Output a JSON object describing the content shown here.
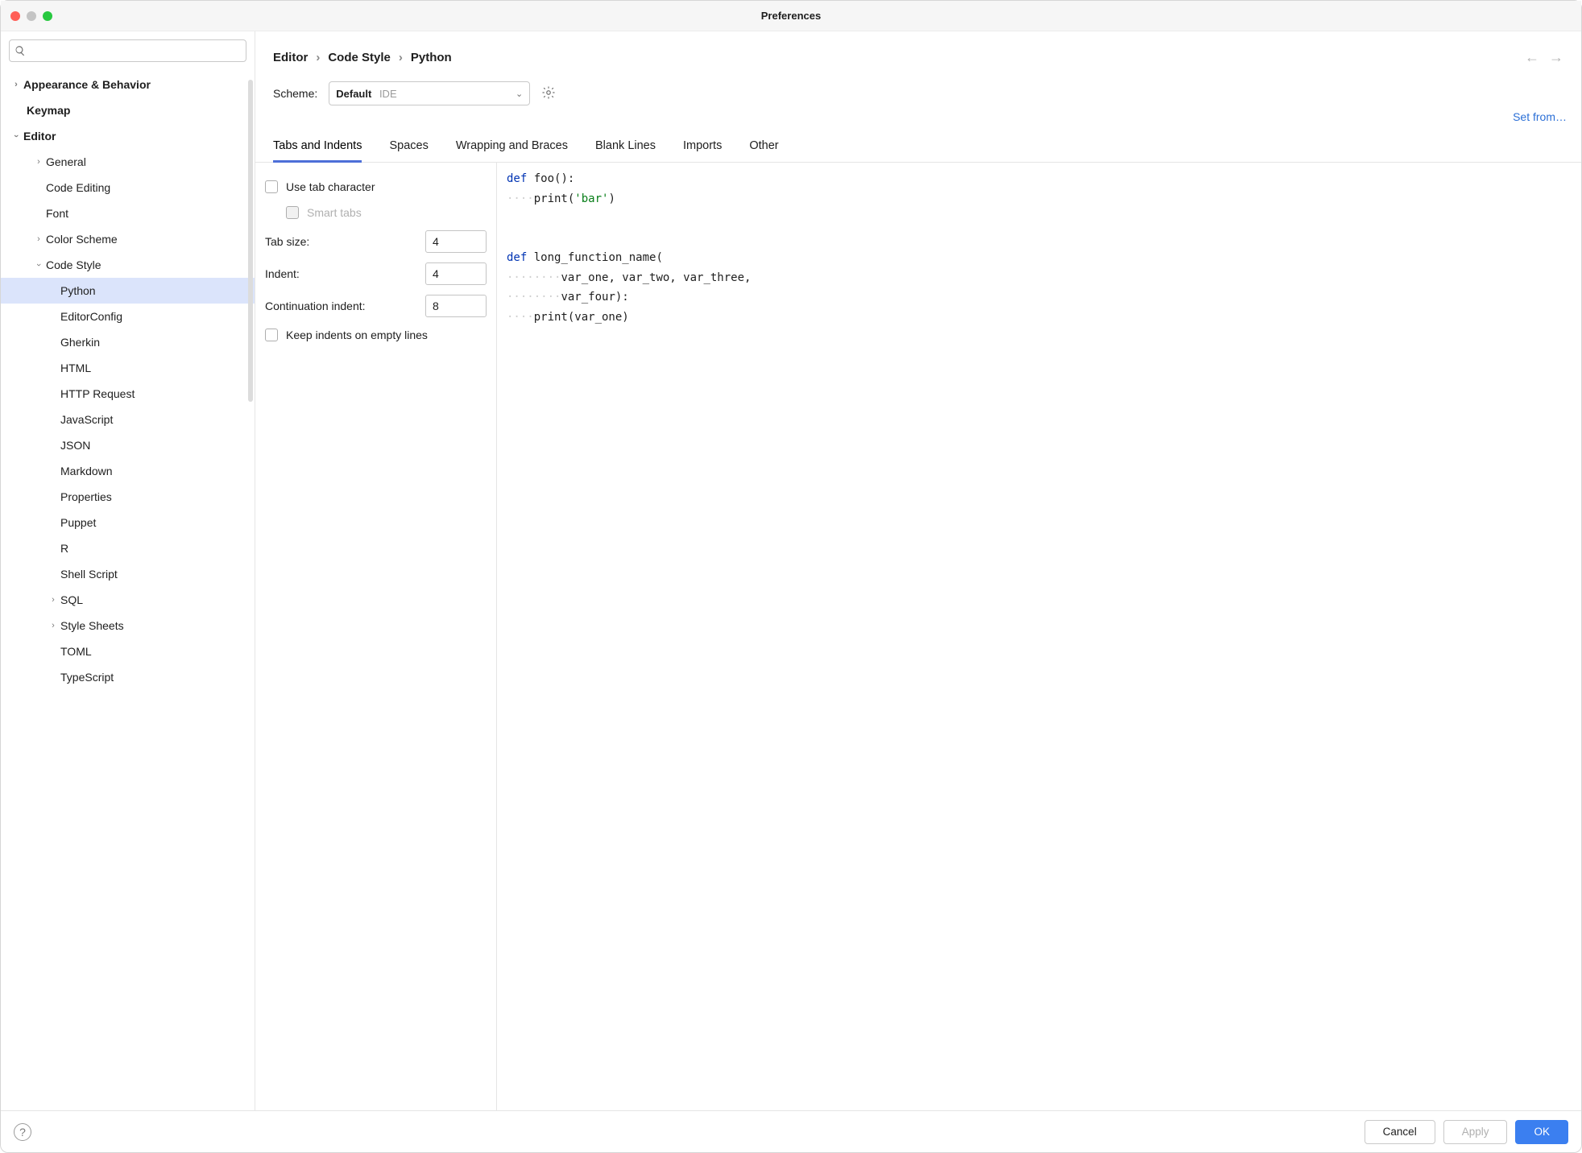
{
  "window": {
    "title": "Preferences"
  },
  "search": {
    "placeholder": ""
  },
  "sidebar": {
    "appearance": "Appearance & Behavior",
    "keymap": "Keymap",
    "editor": "Editor",
    "editor_children": {
      "general": "General",
      "code_editing": "Code Editing",
      "font": "Font",
      "color_scheme": "Color Scheme",
      "code_style": "Code Style",
      "cs": {
        "python": "Python",
        "editorconfig": "EditorConfig",
        "gherkin": "Gherkin",
        "html": "HTML",
        "http": "HTTP Request",
        "javascript": "JavaScript",
        "json": "JSON",
        "markdown": "Markdown",
        "properties": "Properties",
        "puppet": "Puppet",
        "r": "R",
        "shell": "Shell Script",
        "sql": "SQL",
        "stylesheets": "Style Sheets",
        "toml": "TOML",
        "typescript": "TypeScript"
      }
    }
  },
  "breadcrumb": {
    "a": "Editor",
    "b": "Code Style",
    "c": "Python"
  },
  "scheme": {
    "label": "Scheme:",
    "value": "Default",
    "hint": "IDE"
  },
  "setfrom": "Set from…",
  "tabs": {
    "tabs_indents": "Tabs and Indents",
    "spaces": "Spaces",
    "wrapping": "Wrapping and Braces",
    "blank": "Blank Lines",
    "imports": "Imports",
    "other": "Other"
  },
  "form": {
    "use_tab": "Use tab character",
    "smart_tabs": "Smart tabs",
    "tab_size_label": "Tab size:",
    "tab_size": "4",
    "indent_label": "Indent:",
    "indent": "4",
    "cont_label": "Continuation indent:",
    "cont": "8",
    "keep_empty": "Keep indents on empty lines"
  },
  "footer": {
    "cancel": "Cancel",
    "apply": "Apply",
    "ok": "OK"
  }
}
